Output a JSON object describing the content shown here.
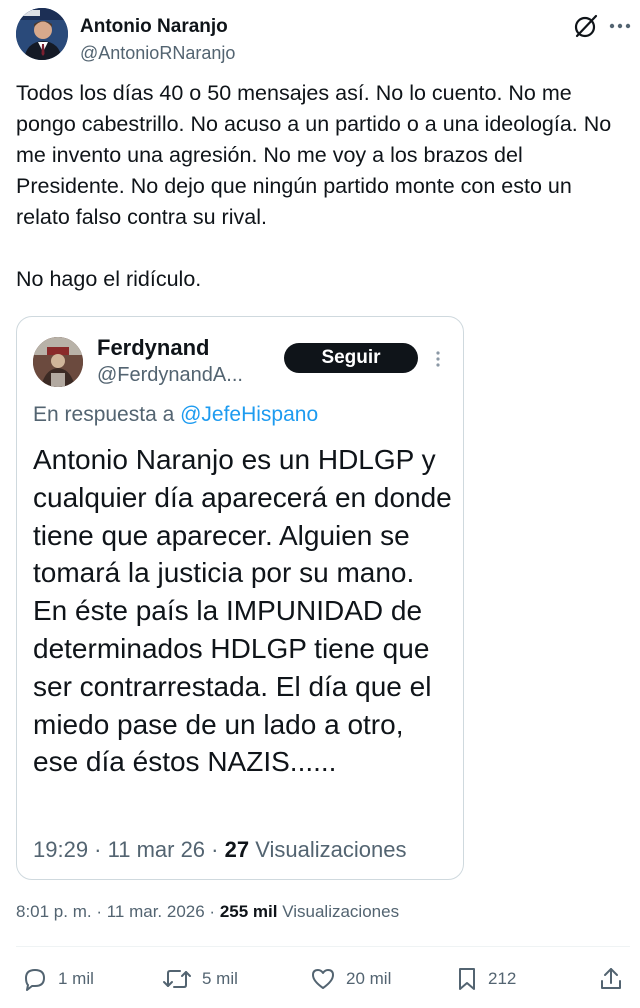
{
  "author": {
    "name": "Antonio Naranjo",
    "handle": "@AntonioRNaranjo"
  },
  "tweet": {
    "paragraphs": [
      "Todos los días 40 o 50 mensajes así. No lo cuento. No me pongo cabestrillo. No acuso a un partido o a una ideología. No me invento una agresión. No me voy a los brazos del Presidente. No dejo que ningún partido monte con esto un relato falso contra su rival.",
      "No hago el ridículo."
    ]
  },
  "quote": {
    "name": "Ferdynand",
    "handle": "@FerdynandA...",
    "follow_label": "Seguir",
    "reply_prefix": "En respuesta a ",
    "reply_to": "@JefeHispano",
    "body": "Antonio Naranjo es un HDLGP y cualquier día aparecerá en donde tiene que aparecer. Alguien se tomará la justicia por su mano. En éste país la IMPUNIDAD de determinados HDLGP tiene que ser contrarrestada. El día que el miedo pase de un lado a otro, ese día éstos NAZIS......",
    "time": "19:29",
    "date": "11 mar 26",
    "views_count": "27",
    "views_label": "Visualizaciones"
  },
  "meta": {
    "time": "8:01 p. m.",
    "date": "11 mar. 2026",
    "views_count": "255 mil",
    "views_label": "Visualizaciones"
  },
  "actions": {
    "replies": "1 mil",
    "reposts": "5 mil",
    "likes": "20 mil",
    "bookmarks": "212"
  },
  "icons": [
    "grok-icon",
    "more-icon",
    "reply-icon",
    "repost-icon",
    "like-icon",
    "bookmark-icon",
    "share-icon"
  ],
  "colors": {
    "text": "#0f1419",
    "secondary": "#536471",
    "link": "#1d9bf0",
    "border": "#cfd9de"
  }
}
